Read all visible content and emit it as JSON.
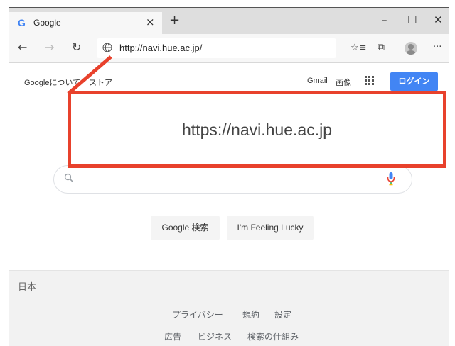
{
  "browser": {
    "tab_title": "Google",
    "tab_favicon": "G",
    "tab_close": "×",
    "new_tab": "+",
    "window_controls": {
      "minimize": "–",
      "maximize": "☐",
      "close": "✕"
    },
    "toolbar": {
      "back": "←",
      "forward": "→",
      "refresh": "↻",
      "favorites": "☆≡",
      "collections": "⧉",
      "more": "···"
    },
    "url": "http://navi.hue.ac.jp/"
  },
  "google": {
    "top_left_links": [
      "Googleについて",
      "ストア"
    ],
    "top_right_links": [
      "Gmail",
      "画像"
    ],
    "login_label": "ログイン",
    "search_buttons": [
      "Google 検索",
      "I'm Feeling Lucky"
    ],
    "country": "日本",
    "footer_row1": [
      "プライバシー",
      "規約",
      "設定"
    ],
    "footer_row2": [
      "広告",
      "ビジネス",
      "検索の仕組み"
    ]
  },
  "annotation": {
    "text": "https://navi.hue.ac.jp",
    "color": "#e8412c"
  },
  "colors": {
    "accent": "#4285f4",
    "annotation": "#e8412c"
  }
}
